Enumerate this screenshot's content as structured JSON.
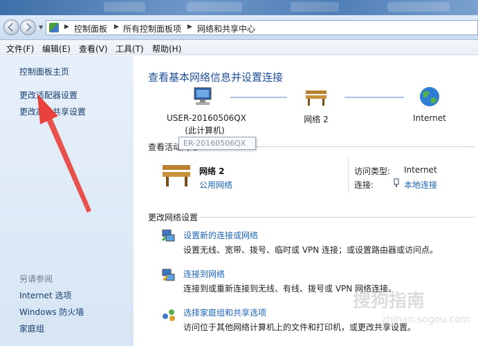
{
  "address_bar": {
    "crumbs": [
      "控制面板",
      "所有控制面板项",
      "网络和共享中心"
    ]
  },
  "menu": [
    "文件(F)",
    "编辑(E)",
    "查看(V)",
    "工具(T)",
    "帮助(H)"
  ],
  "sidebar": {
    "home": "控制面板主页",
    "links": [
      "更改适配器设置",
      "更改高级共享设置"
    ],
    "see_also_heading": "另请参阅",
    "see_also": [
      "Internet 选项",
      "Windows 防火墙",
      "家庭组"
    ]
  },
  "main": {
    "title": "查看基本网络信息并设置连接",
    "map": {
      "computer_name": "USER-20160506QX",
      "computer_sub": "(此计算机)",
      "network": "网络 2",
      "internet": "Internet"
    },
    "active_heading": "查看活动网络",
    "active_network": {
      "name": "网络 2",
      "type": "公用网络",
      "access_type_label": "访问类型:",
      "access_type_value": "Internet",
      "connection_label": "连接:",
      "connection_value": "本地连接"
    },
    "change_heading": "更改网络设置",
    "tasks": [
      {
        "title": "设置新的连接或网络",
        "desc": "设置无线、宽带、拨号、临时或 VPN 连接；或设置路由器或访问点。"
      },
      {
        "title": "连接到网络",
        "desc": "连接到或重新连接到无线、有线、拨号或 VPN 网络连接。"
      },
      {
        "title": "选择家庭组和共享选项",
        "desc": "访问位于其他网络计算机上的文件和打印机，或更改共享设置。"
      }
    ]
  },
  "tooltip": "ER-20160506QX",
  "watermark": "搜狗指南",
  "watermark_sub": "zhinan.sogou.com"
}
